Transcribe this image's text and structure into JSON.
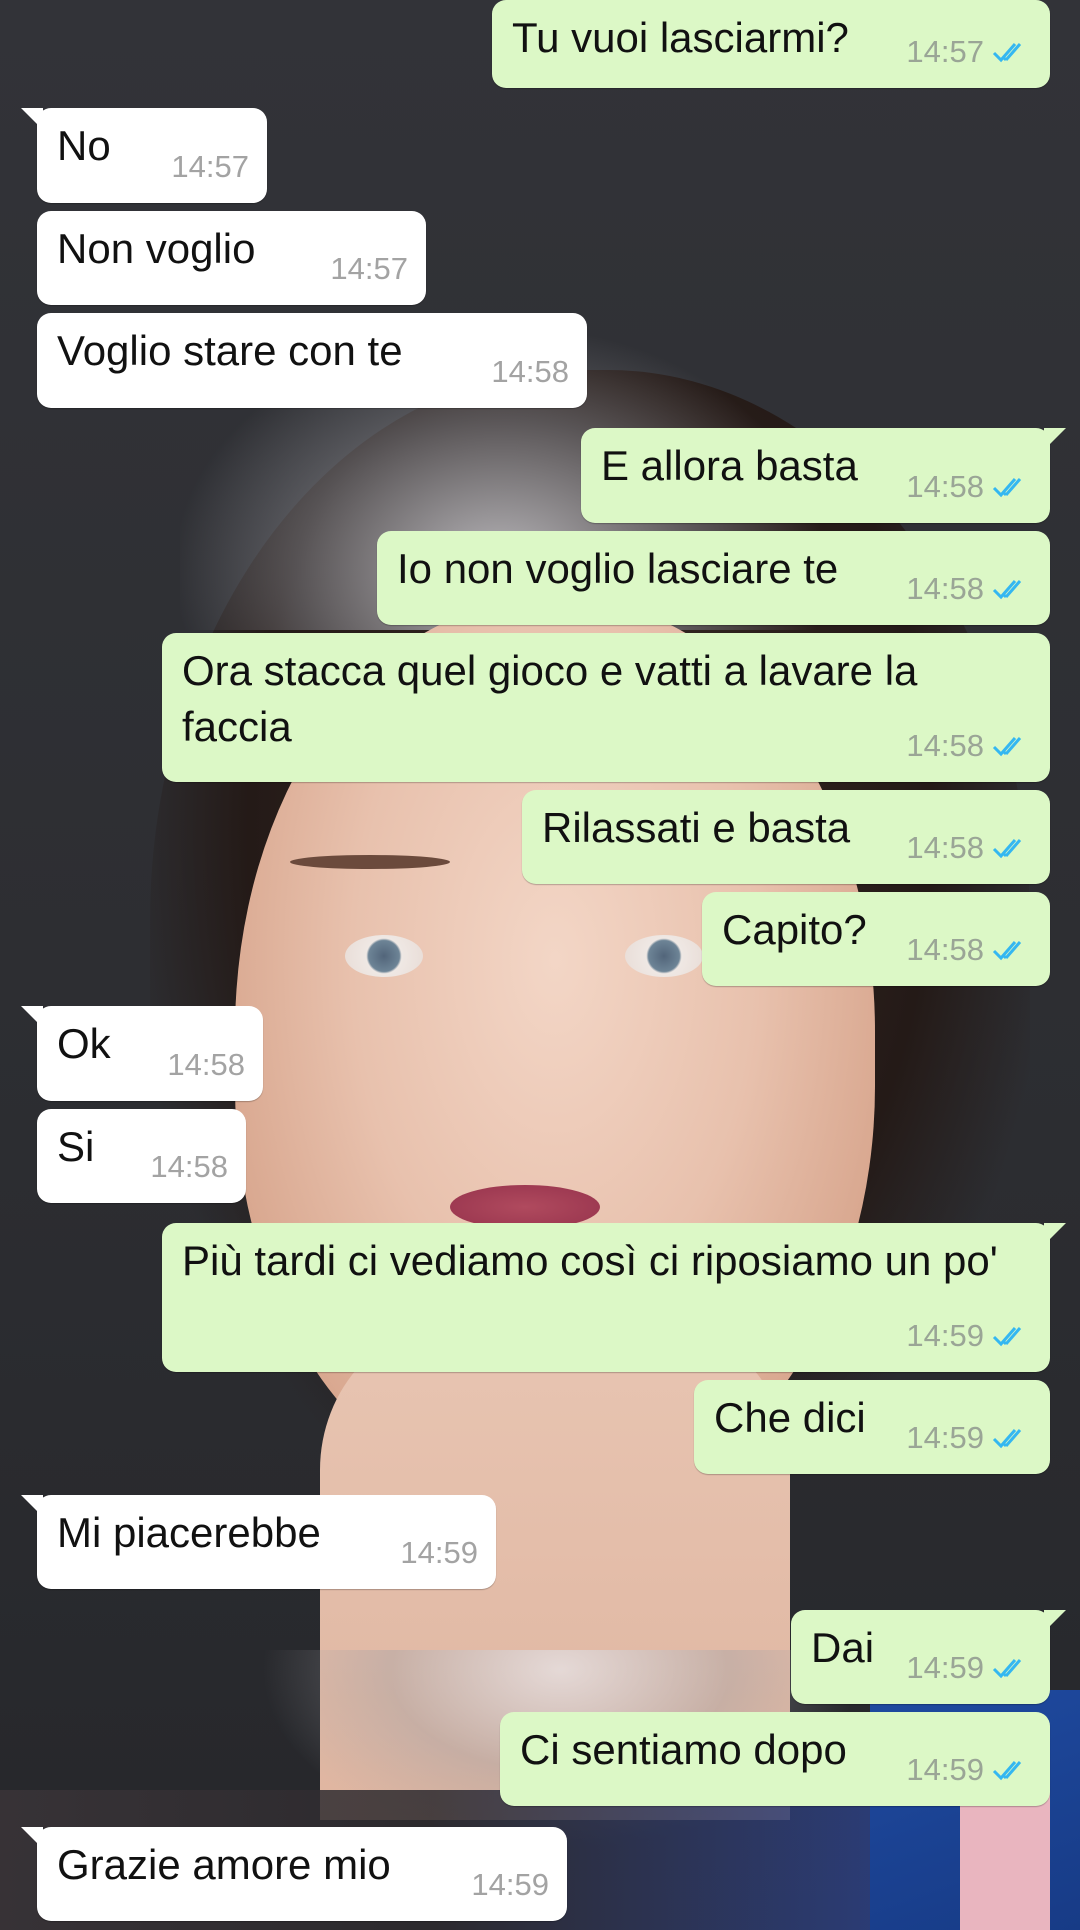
{
  "colors": {
    "outgoing_bubble": "#dcf8c6",
    "incoming_bubble": "#ffffff",
    "read_ticks": "#34b7f1"
  },
  "messages": [
    {
      "dir": "out",
      "text": "Tu vuoi lasciarmi?",
      "time": "14:57",
      "status": "read"
    },
    {
      "dir": "in",
      "text": "No",
      "time": "14:57"
    },
    {
      "dir": "in",
      "text": "Non voglio",
      "time": "14:57"
    },
    {
      "dir": "in",
      "text": "Voglio stare con te",
      "time": "14:58"
    },
    {
      "dir": "out",
      "text": "E allora basta",
      "time": "14:58",
      "status": "read"
    },
    {
      "dir": "out",
      "text": "Io non voglio lasciare te",
      "time": "14:58",
      "status": "read"
    },
    {
      "dir": "out",
      "text": "Ora stacca quel gioco e vatti a lavare la faccia",
      "time": "14:58",
      "status": "read"
    },
    {
      "dir": "out",
      "text": "Rilassati e basta",
      "time": "14:58",
      "status": "read"
    },
    {
      "dir": "out",
      "text": "Capito?",
      "time": "14:58",
      "status": "read"
    },
    {
      "dir": "in",
      "text": "Ok",
      "time": "14:58"
    },
    {
      "dir": "in",
      "text": "Si",
      "time": "14:58"
    },
    {
      "dir": "out",
      "text": "Più tardi ci vediamo così ci riposiamo un po'",
      "time": "14:59",
      "status": "read"
    },
    {
      "dir": "out",
      "text": "Che dici",
      "time": "14:59",
      "status": "read"
    },
    {
      "dir": "in",
      "text": "Mi piacerebbe",
      "time": "14:59"
    },
    {
      "dir": "out",
      "text": "Dai",
      "time": "14:59",
      "status": "read"
    },
    {
      "dir": "out",
      "text": "Ci sentiamo dopo",
      "time": "14:59",
      "status": "read"
    },
    {
      "dir": "in",
      "text": "Grazie amore mio",
      "time": "14:59"
    }
  ]
}
